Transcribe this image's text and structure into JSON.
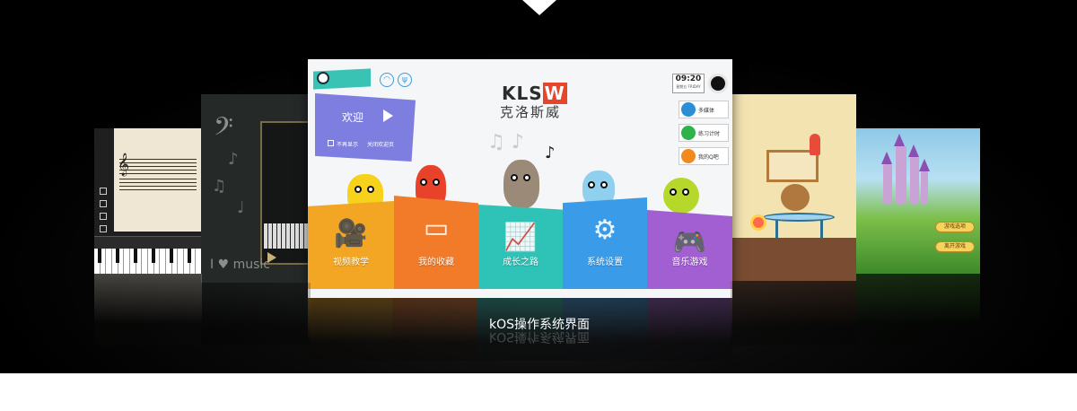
{
  "caption": "kOS操作系统界面",
  "main_screen": {
    "logo": "KLSW",
    "brand_name": "克洛斯威",
    "time": "09:20",
    "date": "星期五 FRIDAY",
    "welcome": {
      "title": "欢迎",
      "dont_show": "不再显示",
      "close": "关闭欢迎页"
    },
    "apps": [
      {
        "label": "多媒体",
        "color": "#2a8fd6"
      },
      {
        "label": "练习计时",
        "color": "#2fb24c"
      },
      {
        "label": "我的Q吧",
        "color": "#f08a1c"
      }
    ],
    "tiles": [
      {
        "label": "视频教学",
        "color": "#f2a623",
        "icon": "video-camera-icon",
        "glyph": "🎥"
      },
      {
        "label": "我的收藏",
        "color": "#f27b2a",
        "icon": "tray-icon",
        "glyph": "▭"
      },
      {
        "label": "成长之路",
        "color": "#2fc2b7",
        "icon": "chart-line-icon",
        "glyph": "📈"
      },
      {
        "label": "系统设置",
        "color": "#3a9be8",
        "icon": "gear-icon",
        "glyph": "⚙"
      },
      {
        "label": "音乐游戏",
        "color": "#a25fd1",
        "icon": "gamepad-icon",
        "glyph": "🎮"
      }
    ]
  },
  "left_screen": {
    "music_text": "I ♥ music"
  },
  "right_castle": {
    "buttons": [
      "游戏选项",
      "离开游戏"
    ]
  }
}
